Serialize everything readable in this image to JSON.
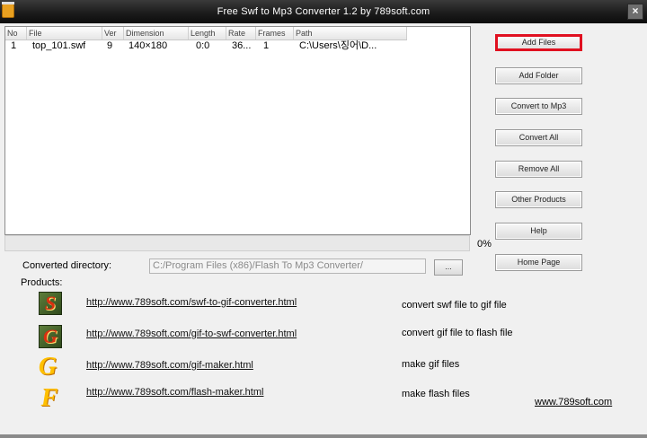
{
  "window": {
    "title": "Free Swf to Mp3 Converter 1.2 by 789soft.com",
    "close_glyph": "×"
  },
  "file_list": {
    "columns": [
      "No",
      "File",
      "Ver",
      "Dimension",
      "Length",
      "Rate",
      "Frames",
      "Path"
    ],
    "rows": [
      {
        "no": "1",
        "file": "top_101.swf",
        "ver": "9",
        "dimension": "140×180",
        "length": "0:0",
        "rate": "36...",
        "frames": "1",
        "path": "C:\\Users\\징어\\D..."
      }
    ]
  },
  "progress": {
    "percent": 0,
    "text": "0%"
  },
  "buttons": {
    "add_files": "Add Files",
    "add_folder": "Add Folder",
    "convert_to_mp3": "Convert to Mp3",
    "convert_all": "Convert All",
    "remove_all": "Remove All",
    "other_products": "Other Products",
    "help": "Help",
    "home_page": "Home Page"
  },
  "directory": {
    "label": "Converted directory:",
    "value": "C:/Program Files (x86)/Flash To Mp3 Converter/",
    "browse_label": "..."
  },
  "products": {
    "label": "Products:",
    "items": [
      {
        "icon": "swf-to-gif-icon",
        "icon_letter": "S",
        "url": "http://www.789soft.com/swf-to-gif-converter.html",
        "desc": "convert swf file to gif file"
      },
      {
        "icon": "gif-to-swf-icon",
        "icon_letter": "G",
        "url": "http://www.789soft.com/gif-to-swf-converter.html",
        "desc": "convert gif file to flash file"
      },
      {
        "icon": "gif-maker-icon",
        "icon_letter": "G",
        "url": "http://www.789soft.com/gif-maker.html",
        "desc": "make gif files"
      },
      {
        "icon": "flash-maker-icon",
        "icon_letter": "F",
        "url": "http://www.789soft.com/flash-maker.html",
        "desc": "make flash files"
      }
    ]
  },
  "site_link": "www.789soft.com",
  "colors": {
    "highlight_border": "#e01020",
    "titlebar": "#1c1c1c"
  }
}
